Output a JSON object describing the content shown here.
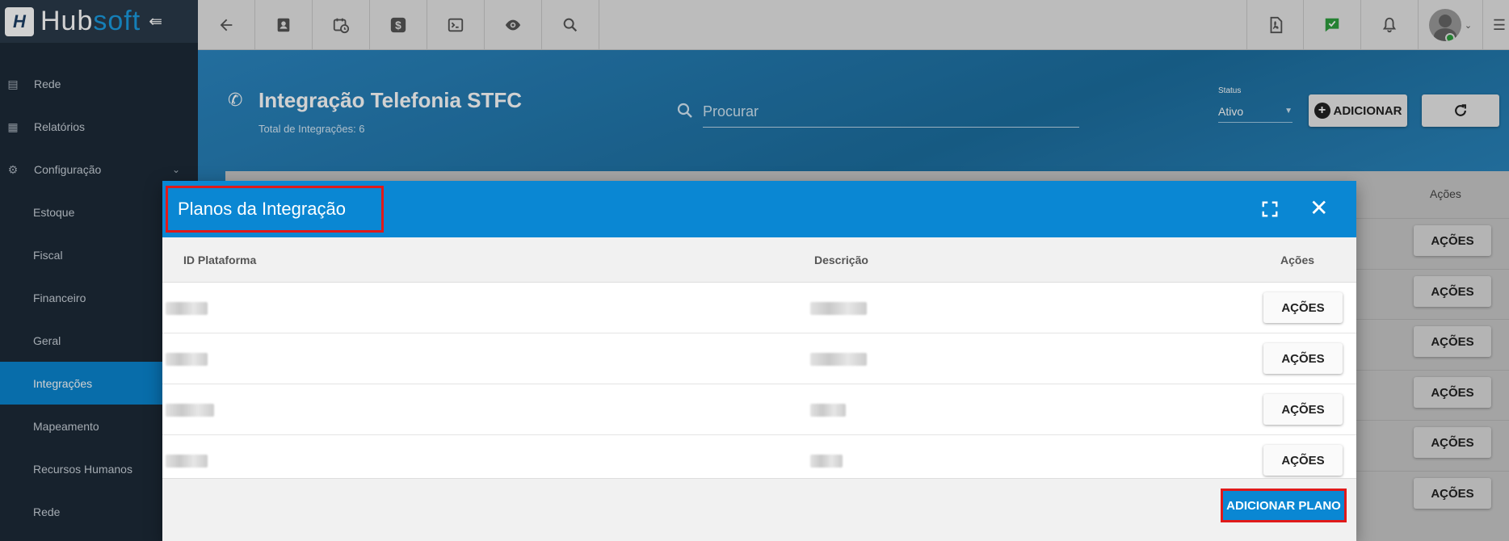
{
  "brand": {
    "name_part1": "Hub",
    "name_part2": "soft",
    "logo_letter": "H"
  },
  "sidebar": {
    "items": [
      {
        "label": "Rede",
        "icon": "server-icon"
      },
      {
        "label": "Relatórios",
        "icon": "document-icon"
      },
      {
        "label": "Configuração",
        "icon": "gear-icon",
        "expanded": true
      },
      {
        "label": "Estoque"
      },
      {
        "label": "Fiscal"
      },
      {
        "label": "Financeiro"
      },
      {
        "label": "Geral"
      },
      {
        "label": "Integrações",
        "active": true
      },
      {
        "label": "Mapeamento"
      },
      {
        "label": "Recursos Humanos"
      },
      {
        "label": "Rede"
      }
    ]
  },
  "topbar": {
    "icons": [
      "back-arrow-icon",
      "contact-card-icon",
      "calendar-clock-icon",
      "dollar-icon",
      "terminal-icon",
      "eye-icon",
      "search-icon",
      "pdf-icon",
      "chat-check-icon",
      "bell-icon",
      "avatar",
      "list-icon"
    ]
  },
  "header": {
    "title": "Integração Telefonia STFC",
    "subtitle": "Total de Integrações: 6",
    "search_placeholder": "Procurar",
    "status_label": "Status",
    "status_value": "Ativo",
    "add_label": "ADICIONAR"
  },
  "background_table": {
    "acoes_header": "Ações",
    "row_button": "AÇÕES"
  },
  "modal": {
    "title": "Planos da Integração",
    "columns": [
      "ID Plataforma",
      "Descrição",
      "Ações"
    ],
    "row_button": "AÇÕES",
    "rows": 4,
    "add_plan_label": "ADICIONAR PLANO"
  },
  "colors": {
    "accent": "#0a87d3",
    "sidebar_bg": "#1d2a37",
    "highlight": "#e01a1a"
  }
}
